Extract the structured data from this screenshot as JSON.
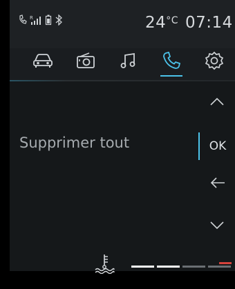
{
  "status": {
    "temperature": "24",
    "temp_unit": "°C",
    "time": "07:14",
    "icons": [
      "phone-status-icon",
      "signal-icon",
      "battery-icon",
      "bluetooth-icon"
    ]
  },
  "tabs": [
    {
      "name": "car-icon",
      "active": false
    },
    {
      "name": "radio-icon",
      "active": false
    },
    {
      "name": "music-icon",
      "active": false
    },
    {
      "name": "phone-icon",
      "active": true
    },
    {
      "name": "settings-icon",
      "active": false
    }
  ],
  "main": {
    "delete_all_label": "Supprimer tout"
  },
  "side_controls": {
    "up": "chevron-up-icon",
    "ok_label": "OK",
    "back": "arrow-left-icon",
    "down": "chevron-down-icon"
  },
  "gauge": {
    "icon": "coolant-temperature-icon",
    "segments_lit": 2,
    "segments_total": 4,
    "colors": {
      "lit": "#ffffff",
      "unlit": "#6a6f73",
      "warning": "#d5423c",
      "accent": "#4cc3ea"
    }
  }
}
